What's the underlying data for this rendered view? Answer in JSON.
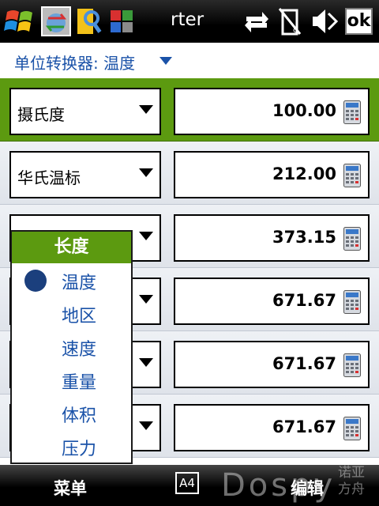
{
  "statusbar": {
    "title_fragment": "rter",
    "ok_label": "ok",
    "icons": [
      "windows-start-icon",
      "converter-app-icon",
      "search-tool-icon",
      "task-tiles-icon",
      "connectivity-icon",
      "signal-icon",
      "volume-muted-icon"
    ]
  },
  "header": {
    "title": "单位转换器: 温度"
  },
  "rows": [
    {
      "unit": "摄氏度",
      "value": "100.00",
      "selected": true
    },
    {
      "unit": "华氏温标",
      "value": "212.00",
      "selected": false
    },
    {
      "unit": "",
      "value": "373.15",
      "selected": false
    },
    {
      "unit": "",
      "value": "671.67",
      "selected": false
    },
    {
      "unit": "",
      "value": "671.67",
      "selected": false
    },
    {
      "unit": "",
      "value": "671.67",
      "selected": false
    }
  ],
  "dropdown": {
    "header": "长度",
    "items": [
      "温度",
      "地区",
      "速度",
      "重量",
      "体积",
      "压力"
    ],
    "selected_index": 0
  },
  "bottombar": {
    "left_label": "菜单",
    "right_label": "编辑",
    "keyboard_label": "A4",
    "watermark": "Dospy",
    "watermark_cn": "诺亚方舟"
  },
  "colors": {
    "accent_green": "#5c9a10",
    "link_blue": "#1a52a8"
  }
}
